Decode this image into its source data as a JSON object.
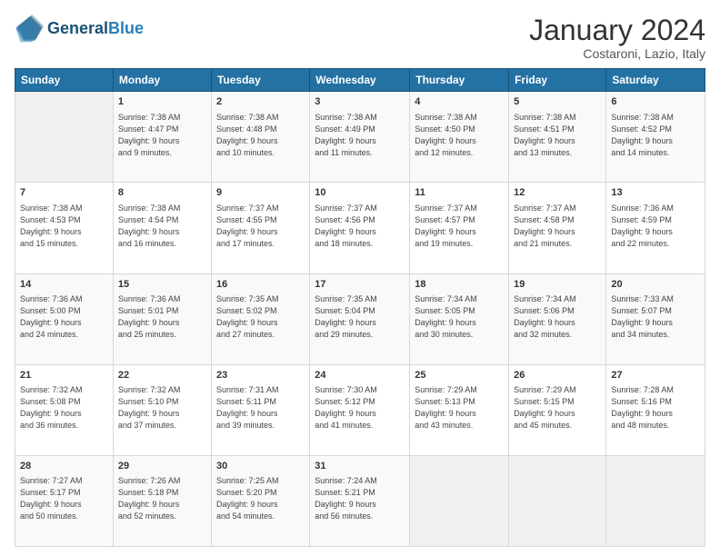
{
  "header": {
    "logo_general": "General",
    "logo_blue": "Blue",
    "month": "January 2024",
    "location": "Costaroni, Lazio, Italy"
  },
  "columns": [
    "Sunday",
    "Monday",
    "Tuesday",
    "Wednesday",
    "Thursday",
    "Friday",
    "Saturday"
  ],
  "weeks": [
    [
      {
        "day": "",
        "info": ""
      },
      {
        "day": "1",
        "info": "Sunrise: 7:38 AM\nSunset: 4:47 PM\nDaylight: 9 hours\nand 9 minutes."
      },
      {
        "day": "2",
        "info": "Sunrise: 7:38 AM\nSunset: 4:48 PM\nDaylight: 9 hours\nand 10 minutes."
      },
      {
        "day": "3",
        "info": "Sunrise: 7:38 AM\nSunset: 4:49 PM\nDaylight: 9 hours\nand 11 minutes."
      },
      {
        "day": "4",
        "info": "Sunrise: 7:38 AM\nSunset: 4:50 PM\nDaylight: 9 hours\nand 12 minutes."
      },
      {
        "day": "5",
        "info": "Sunrise: 7:38 AM\nSunset: 4:51 PM\nDaylight: 9 hours\nand 13 minutes."
      },
      {
        "day": "6",
        "info": "Sunrise: 7:38 AM\nSunset: 4:52 PM\nDaylight: 9 hours\nand 14 minutes."
      }
    ],
    [
      {
        "day": "7",
        "info": "Sunrise: 7:38 AM\nSunset: 4:53 PM\nDaylight: 9 hours\nand 15 minutes."
      },
      {
        "day": "8",
        "info": "Sunrise: 7:38 AM\nSunset: 4:54 PM\nDaylight: 9 hours\nand 16 minutes."
      },
      {
        "day": "9",
        "info": "Sunrise: 7:37 AM\nSunset: 4:55 PM\nDaylight: 9 hours\nand 17 minutes."
      },
      {
        "day": "10",
        "info": "Sunrise: 7:37 AM\nSunset: 4:56 PM\nDaylight: 9 hours\nand 18 minutes."
      },
      {
        "day": "11",
        "info": "Sunrise: 7:37 AM\nSunset: 4:57 PM\nDaylight: 9 hours\nand 19 minutes."
      },
      {
        "day": "12",
        "info": "Sunrise: 7:37 AM\nSunset: 4:58 PM\nDaylight: 9 hours\nand 21 minutes."
      },
      {
        "day": "13",
        "info": "Sunrise: 7:36 AM\nSunset: 4:59 PM\nDaylight: 9 hours\nand 22 minutes."
      }
    ],
    [
      {
        "day": "14",
        "info": "Sunrise: 7:36 AM\nSunset: 5:00 PM\nDaylight: 9 hours\nand 24 minutes."
      },
      {
        "day": "15",
        "info": "Sunrise: 7:36 AM\nSunset: 5:01 PM\nDaylight: 9 hours\nand 25 minutes."
      },
      {
        "day": "16",
        "info": "Sunrise: 7:35 AM\nSunset: 5:02 PM\nDaylight: 9 hours\nand 27 minutes."
      },
      {
        "day": "17",
        "info": "Sunrise: 7:35 AM\nSunset: 5:04 PM\nDaylight: 9 hours\nand 29 minutes."
      },
      {
        "day": "18",
        "info": "Sunrise: 7:34 AM\nSunset: 5:05 PM\nDaylight: 9 hours\nand 30 minutes."
      },
      {
        "day": "19",
        "info": "Sunrise: 7:34 AM\nSunset: 5:06 PM\nDaylight: 9 hours\nand 32 minutes."
      },
      {
        "day": "20",
        "info": "Sunrise: 7:33 AM\nSunset: 5:07 PM\nDaylight: 9 hours\nand 34 minutes."
      }
    ],
    [
      {
        "day": "21",
        "info": "Sunrise: 7:32 AM\nSunset: 5:08 PM\nDaylight: 9 hours\nand 36 minutes."
      },
      {
        "day": "22",
        "info": "Sunrise: 7:32 AM\nSunset: 5:10 PM\nDaylight: 9 hours\nand 37 minutes."
      },
      {
        "day": "23",
        "info": "Sunrise: 7:31 AM\nSunset: 5:11 PM\nDaylight: 9 hours\nand 39 minutes."
      },
      {
        "day": "24",
        "info": "Sunrise: 7:30 AM\nSunset: 5:12 PM\nDaylight: 9 hours\nand 41 minutes."
      },
      {
        "day": "25",
        "info": "Sunrise: 7:29 AM\nSunset: 5:13 PM\nDaylight: 9 hours\nand 43 minutes."
      },
      {
        "day": "26",
        "info": "Sunrise: 7:29 AM\nSunset: 5:15 PM\nDaylight: 9 hours\nand 45 minutes."
      },
      {
        "day": "27",
        "info": "Sunrise: 7:28 AM\nSunset: 5:16 PM\nDaylight: 9 hours\nand 48 minutes."
      }
    ],
    [
      {
        "day": "28",
        "info": "Sunrise: 7:27 AM\nSunset: 5:17 PM\nDaylight: 9 hours\nand 50 minutes."
      },
      {
        "day": "29",
        "info": "Sunrise: 7:26 AM\nSunset: 5:18 PM\nDaylight: 9 hours\nand 52 minutes."
      },
      {
        "day": "30",
        "info": "Sunrise: 7:25 AM\nSunset: 5:20 PM\nDaylight: 9 hours\nand 54 minutes."
      },
      {
        "day": "31",
        "info": "Sunrise: 7:24 AM\nSunset: 5:21 PM\nDaylight: 9 hours\nand 56 minutes."
      },
      {
        "day": "",
        "info": ""
      },
      {
        "day": "",
        "info": ""
      },
      {
        "day": "",
        "info": ""
      }
    ]
  ]
}
